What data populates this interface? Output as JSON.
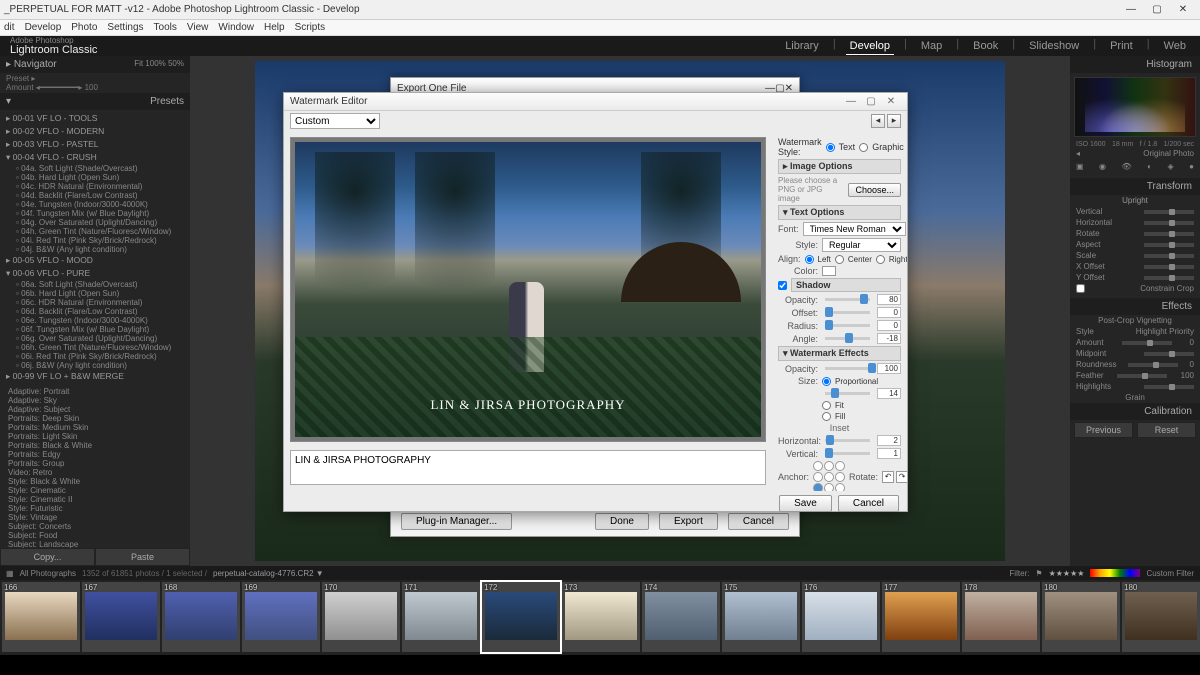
{
  "titlebar": {
    "text": "_PERPETUAL FOR MATT -v12 - Adobe Photoshop Lightroom Classic - Develop"
  },
  "menu": [
    "dit",
    "Develop",
    "Photo",
    "Settings",
    "Tools",
    "View",
    "Window",
    "Help",
    "Scripts"
  ],
  "brand": {
    "small": "Adobe Photoshop",
    "main": "Lightroom Classic"
  },
  "modules": [
    "Library",
    "Develop",
    "Map",
    "Book",
    "Slideshow",
    "Print",
    "Web"
  ],
  "modules_active": "Develop",
  "left": {
    "navigator": {
      "title": "Navigator",
      "zoom": "Fit   100%   50%"
    },
    "presets_title": "Presets",
    "folders": [
      "00-01 VF LO - TOOLS",
      "00-02 VFLO - MODERN",
      "00-03 VFLO - PASTEL",
      "00-04 VFLO - CRUSH"
    ],
    "items04": [
      "04a. Soft Light (Shade/Overcast)",
      "04b. Hard Light (Open Sun)",
      "04c. HDR Natural (Environmental)",
      "04d. Backlit (Flare/Low Contrast)",
      "04e. Tungsten (Indoor/3000-4000K)",
      "04f. Tungsten Mix (w/ Blue Daylight)",
      "04g. Over Saturated (Uplight/Dancing)",
      "04h. Green Tint (Nature/Fluoresc/Window)",
      "04i. Red Tint (Pink Sky/Brick/Redrock)",
      "04j. B&W (Any light condition)"
    ],
    "folders2": [
      "00-05 VFLO - MOOD",
      "00-06 VFLO - PURE"
    ],
    "items06": [
      "06a. Soft Light (Shade/Overcast)",
      "06b. Hard Light (Open Sun)",
      "06c. HDR Natural (Environmental)",
      "06d. Backlit (Flare/Low Contrast)",
      "06e. Tungsten (Indoor/3000-4000K)",
      "06f. Tungsten Mix (w/ Blue Daylight)",
      "06g. Over Saturated (Uplight/Dancing)",
      "06h. Green Tint (Nature/Fluoresc/Window)",
      "06i. Red Tint (Pink Sky/Brick/Redrock)",
      "06j. B&W (Any light condition)"
    ],
    "folder99": "00-99 VF LO + B&W MERGE",
    "styles": [
      "Adaptive: Portrait",
      "Adaptive: Sky",
      "Adaptive: Subject",
      "Portraits: Deep Skin",
      "Portraits: Medium Skin",
      "Portraits: Light Skin",
      "Portraits: Black & White",
      "Portraits: Edgy",
      "Portraits: Group",
      "Video: Retro",
      "Style: Black & White",
      "Style: Cinematic",
      "Style: Cinematic II",
      "Style: Futuristic",
      "Style: Vintage",
      "Subject: Concerts",
      "Subject: Food",
      "Subject: Landscape"
    ],
    "copy": "Copy...",
    "paste": "Paste"
  },
  "right": {
    "histogram_title": "Histogram",
    "iso": "ISO 1600",
    "mm": "18 mm",
    "f": "f / 1.8",
    "s": "1/200 sec",
    "original": "Original Photo",
    "transform_title": "Transform",
    "upright": "Upright",
    "transform_rows": [
      "Vertical",
      "Horizontal",
      "Rotate",
      "Aspect",
      "Scale",
      "X Offset",
      "Y Offset"
    ],
    "constrain": "Constrain Crop",
    "effects_title": "Effects",
    "vignette": "Post-Crop Vignetting",
    "vignette_style": "Highlight Priority",
    "effects_rows": [
      "Amount",
      "Midpoint",
      "Roundness",
      "Feather",
      "Highlights"
    ],
    "amount_val": "0",
    "midpoint_val": "",
    "roundness_val": "0",
    "feather_val": "100",
    "highlights_val": "",
    "grain": "Grain",
    "calibration_title": "Calibration",
    "previous": "Previous",
    "reset": "Reset"
  },
  "filmstrip": {
    "label": "All Photographs",
    "count": "1352 of 61851 photos / 1 selected /",
    "path": "perpetual-catalog-4776.CR2 ▼",
    "filter": "Filter:",
    "custom": "Custom Filter",
    "thumbs": [
      166,
      167,
      168,
      169,
      170,
      171,
      172,
      173,
      174,
      175,
      176,
      177,
      178,
      180
    ],
    "selected": 172
  },
  "export_dialog": {
    "title": "Export One File",
    "plugin": "Plug-in Manager...",
    "done": "Done",
    "export": "Export",
    "cancel": "Cancel"
  },
  "watermark": {
    "title": "Watermark Editor",
    "preset": "Custom",
    "style_label": "Watermark Style:",
    "style_text": "Text",
    "style_graphic": "Graphic",
    "img_options": "Image Options",
    "choose_hint": "Please choose a PNG or JPG image",
    "choose": "Choose...",
    "text_options": "Text Options",
    "font_label": "Font:",
    "font": "Times New Roman",
    "fstyle_label": "Style:",
    "fstyle": "Regular",
    "align_label": "Align:",
    "align_left": "Left",
    "align_center": "Center",
    "align_right": "Right",
    "color_label": "Color:",
    "shadow": "Shadow",
    "opacity": "Opacity:",
    "opacity_val": "80",
    "offset": "Offset:",
    "offset_val": "0",
    "radius": "Radius:",
    "radius_val": "0",
    "angle": "Angle:",
    "angle_val": "-18",
    "effects": "Watermark Effects",
    "effects_opacity": "Opacity:",
    "effects_opacity_val": "100",
    "size": "Size:",
    "size_prop": "Proportional",
    "size_val": "14",
    "fit": "Fit",
    "fill": "Fill",
    "inset": "Inset",
    "horizontal": "Horizontal:",
    "horizontal_val": "2",
    "vertical": "Vertical:",
    "vertical_val": "1",
    "anchor": "Anchor:",
    "rotate": "Rotate:",
    "watermark_text": "LIN & JIRSA PHOTOGRAPHY",
    "input_text": "LIN & JIRSA PHOTOGRAPHY",
    "save": "Save",
    "cancel": "Cancel"
  }
}
